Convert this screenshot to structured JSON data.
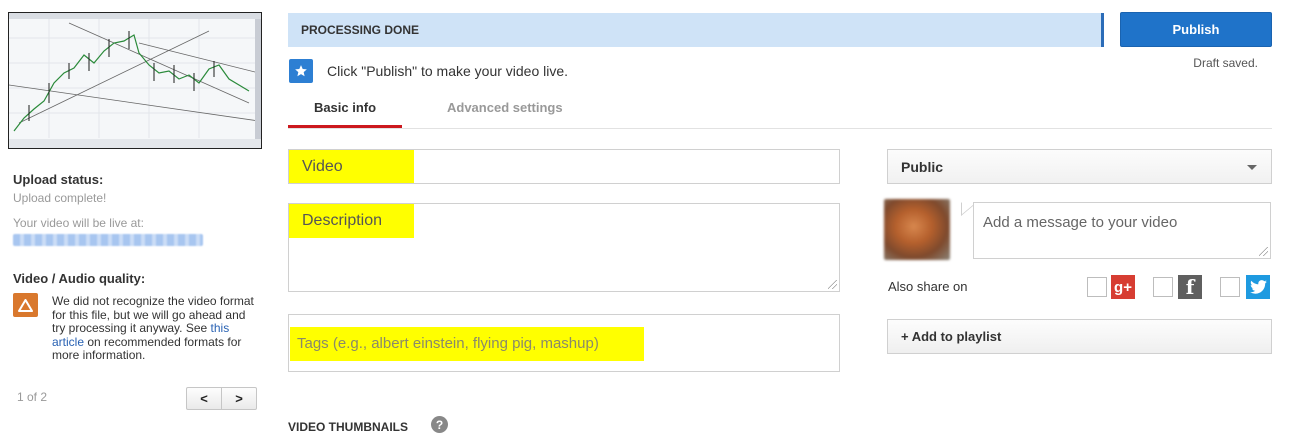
{
  "left_panel": {
    "upload_status_heading": "Upload status:",
    "upload_status_value": "Upload complete!",
    "live_at_label": "Your video will be live at:",
    "quality_heading": "Video / Audio quality:",
    "quality_message_before": "We did not recognize the video format for this file, but we will go ahead and try processing it anyway. See ",
    "quality_link": "this article",
    "quality_message_after": " on recommended formats for more information.",
    "pager_text": "1 of 2",
    "pager_prev": "<",
    "pager_next": ">"
  },
  "banner": {
    "status": "PROCESSING DONE",
    "publish_label": "Publish",
    "draft_saved": "Draft saved.",
    "hint": "Click \"Publish\" to make your video live."
  },
  "tabs": [
    {
      "label": "Basic info",
      "active": true
    },
    {
      "label": "Advanced settings",
      "active": false
    }
  ],
  "form": {
    "title_value": "Video",
    "description_value": "Description",
    "tags_placeholder": "Tags (e.g., albert einstein, flying pig, mashup)"
  },
  "right_panel": {
    "privacy_value": "Public",
    "share_placeholder": "Add a message to your video",
    "also_share_label": "Also share on",
    "google_glyph": "g+",
    "facebook_glyph": "f",
    "playlist_label": "+ Add to playlist"
  },
  "footer": {
    "thumbnails_heading": "VIDEO THUMBNAILS",
    "help_glyph": "?"
  },
  "icons": {
    "star": "star-icon",
    "warning": "warning-icon",
    "caret": "chevron-down-icon",
    "help": "help-icon"
  },
  "colors": {
    "publish_blue": "#1f73c9",
    "banner_blue": "#cfe3f7",
    "tab_red": "#cc181e",
    "highlight_yellow": "#ffff00",
    "warning_orange": "#d9782d",
    "google_red": "#d73d32",
    "twitter_blue": "#1e9ae0"
  }
}
